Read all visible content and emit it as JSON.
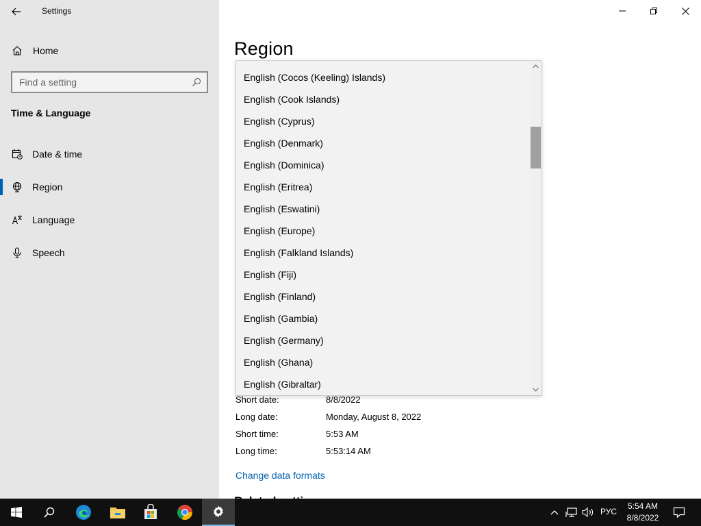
{
  "window": {
    "title": "Settings"
  },
  "sidebar": {
    "home_label": "Home",
    "search_placeholder": "Find a setting",
    "section_title": "Time & Language",
    "items": [
      {
        "label": "Date & time",
        "icon": "date-time-icon",
        "active": false
      },
      {
        "label": "Region",
        "icon": "region-globe-icon",
        "active": true
      },
      {
        "label": "Language",
        "icon": "language-icon",
        "active": false
      },
      {
        "label": "Speech",
        "icon": "microphone-icon",
        "active": false
      }
    ]
  },
  "main": {
    "page_title": "Region",
    "formats": [
      {
        "label": "Short date:",
        "value": "8/8/2022"
      },
      {
        "label": "Long date:",
        "value": "Monday, August 8, 2022"
      },
      {
        "label": "Short time:",
        "value": "5:53 AM"
      },
      {
        "label": "Long time:",
        "value": "5:53:14 AM"
      }
    ],
    "change_link": "Change data formats",
    "related_heading": "Related settings"
  },
  "dropdown": {
    "options": [
      "English (Cocos (Keeling) Islands)",
      "English (Cook Islands)",
      "English (Cyprus)",
      "English (Denmark)",
      "English (Dominica)",
      "English (Eritrea)",
      "English (Eswatini)",
      "English (Europe)",
      "English (Falkland Islands)",
      "English (Fiji)",
      "English (Finland)",
      "English (Gambia)",
      "English (Germany)",
      "English (Ghana)",
      "English (Gibraltar)"
    ]
  },
  "taskbar": {
    "apps": [
      "start-icon",
      "search-icon",
      "edge-icon",
      "file-explorer-icon",
      "store-icon",
      "chrome-icon",
      "settings-gear-icon"
    ],
    "lang": "РУС",
    "time": "5:54 AM",
    "date": "8/8/2022"
  },
  "colors": {
    "accent": "#0063b1",
    "sidebar_bg": "#e6e6e6",
    "taskbar_bg": "#101010"
  }
}
